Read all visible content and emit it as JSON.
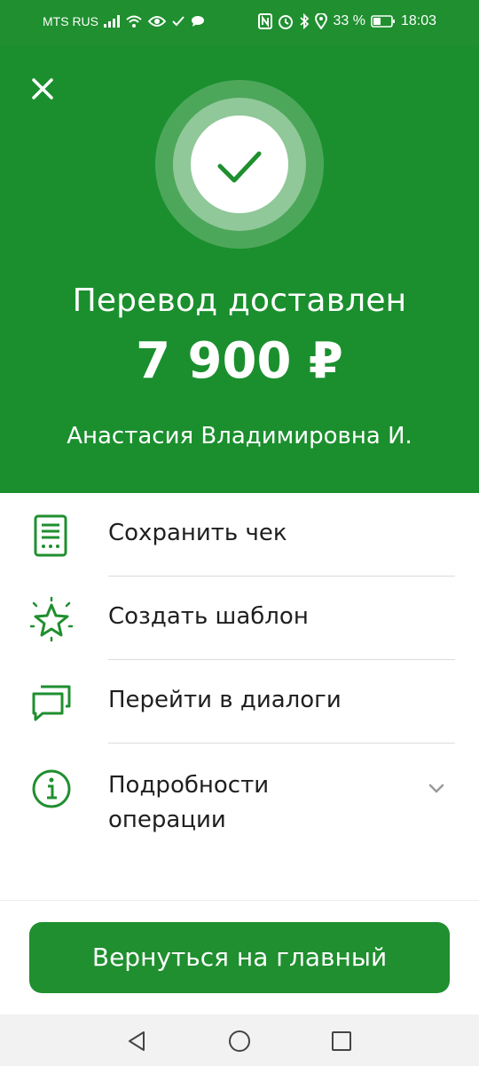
{
  "status_bar": {
    "carrier": "MTS RUS",
    "battery_percent": "33 %",
    "time": "18:03",
    "icons": [
      "signal-icon",
      "wifi-icon",
      "eye-icon",
      "check-icon",
      "chat-bubble-icon",
      "nfc-icon",
      "alarm-icon",
      "bluetooth-icon",
      "location-icon",
      "battery-icon"
    ]
  },
  "hero": {
    "title": "Перевод доставлен",
    "amount": "7 900 ₽",
    "recipient": "Анастасия Владимировна И."
  },
  "actions": [
    {
      "label": "Сохранить чек",
      "icon": "receipt-icon"
    },
    {
      "label": "Создать шаблон",
      "icon": "star-icon"
    },
    {
      "label": "Перейти в диалоги",
      "icon": "chat-icon"
    },
    {
      "label": "Подробности операции",
      "icon": "info-icon"
    }
  ],
  "main_button": {
    "label": "Вернуться на главный"
  },
  "navigation": {
    "icons": [
      "back-icon",
      "home-icon",
      "recents-icon"
    ]
  },
  "colors": {
    "accent": "#1f8f2f",
    "background": "#ffffff"
  }
}
